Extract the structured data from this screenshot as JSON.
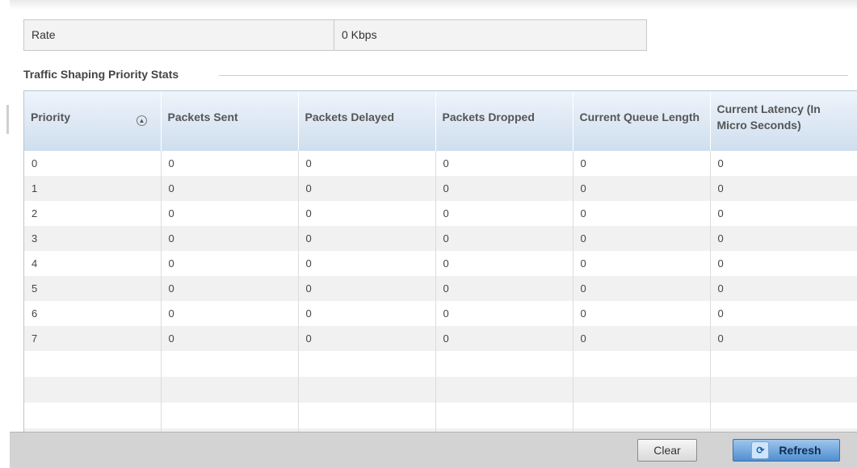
{
  "rate": {
    "label": "Rate",
    "value": "0 Kbps"
  },
  "section": {
    "title": "Traffic Shaping Priority Stats"
  },
  "table": {
    "columns": [
      "Priority",
      "Packets Sent",
      "Packets Delayed",
      "Packets Dropped",
      "Current Queue Length",
      "Current Latency (In Micro Seconds)"
    ],
    "rows": [
      [
        "0",
        "0",
        "0",
        "0",
        "0",
        "0"
      ],
      [
        "1",
        "0",
        "0",
        "0",
        "0",
        "0"
      ],
      [
        "2",
        "0",
        "0",
        "0",
        "0",
        "0"
      ],
      [
        "3",
        "0",
        "0",
        "0",
        "0",
        "0"
      ],
      [
        "4",
        "0",
        "0",
        "0",
        "0",
        "0"
      ],
      [
        "5",
        "0",
        "0",
        "0",
        "0",
        "0"
      ],
      [
        "6",
        "0",
        "0",
        "0",
        "0",
        "0"
      ],
      [
        "7",
        "0",
        "0",
        "0",
        "0",
        "0"
      ]
    ],
    "sort_icon": "sort-ascending-icon"
  },
  "buttons": {
    "clear": "Clear",
    "refresh": "Refresh",
    "refresh_icon": "refresh-icon"
  }
}
